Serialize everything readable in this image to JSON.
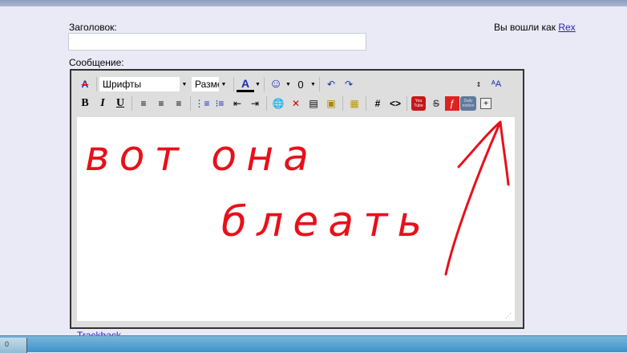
{
  "form": {
    "title_label": "Заголовок:",
    "title_value": "",
    "message_label": "Сообщение:",
    "trackback": "Trackback"
  },
  "login": {
    "prefix": "Вы вошли как",
    "user": "Rex"
  },
  "toolbar": {
    "font_select": "Шрифты",
    "size_select": "Разме",
    "icons_row1": [
      "remove-format-icon",
      "font-color-icon",
      "smiley-icon",
      "attachment-icon",
      "undo-icon",
      "redo-icon",
      "resize-icon",
      "spellcheck-icon"
    ],
    "bold": "B",
    "italic": "I",
    "underline": "U",
    "hash": "#",
    "code": "<>",
    "youtube": "You Tube",
    "dailymotion": "Daily motion",
    "more": "+"
  },
  "drawing": {
    "text": "вот она блеать",
    "color": "#e8101a"
  },
  "taskbar": {
    "item": "0"
  }
}
